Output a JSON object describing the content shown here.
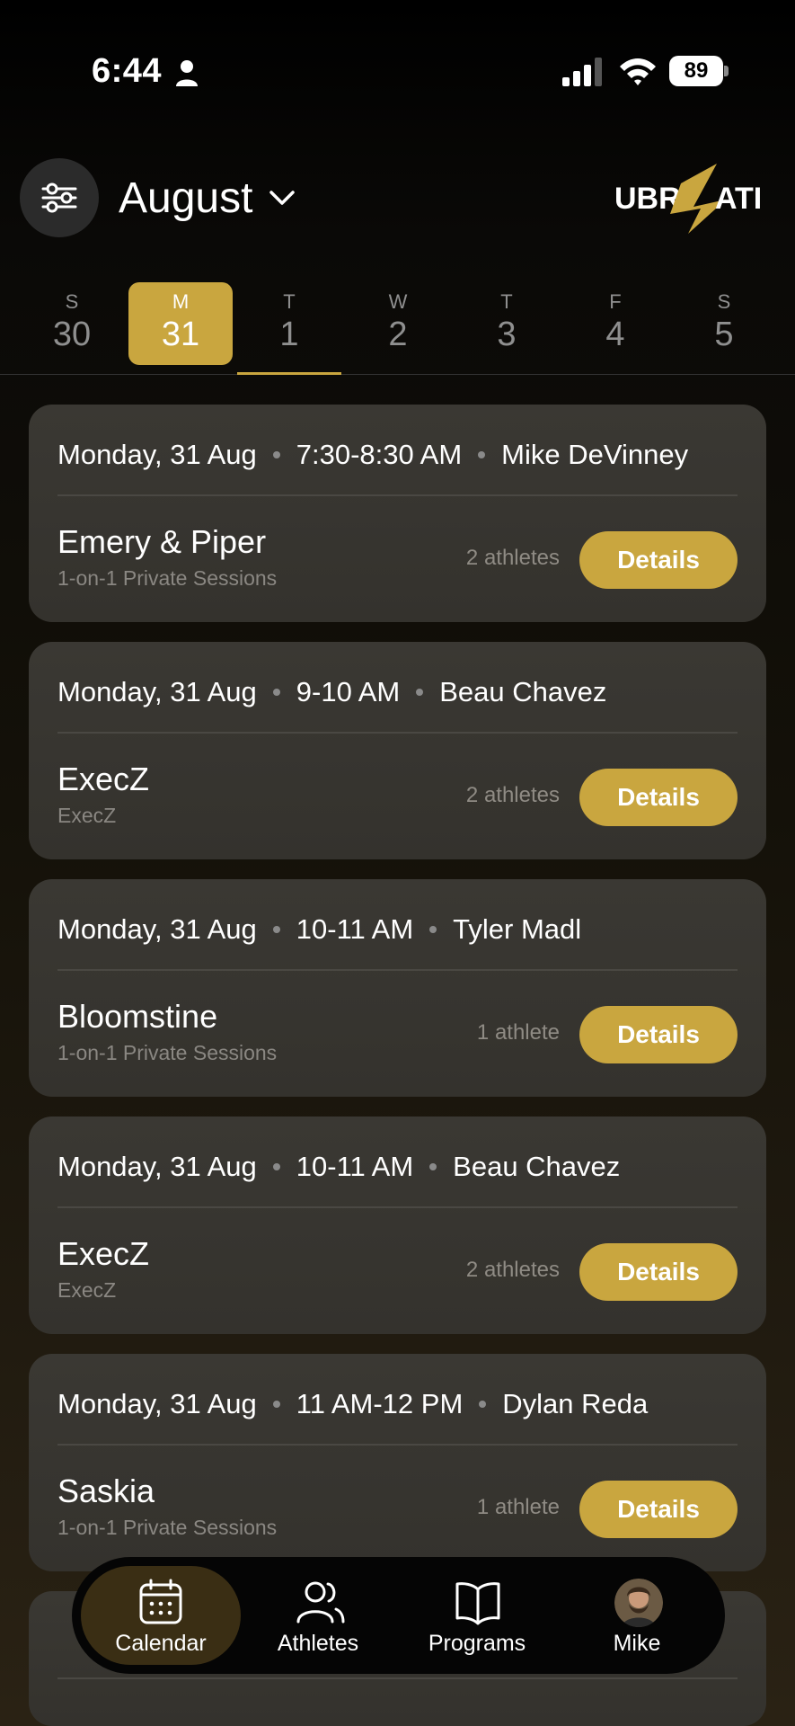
{
  "status_bar": {
    "time": "6:44",
    "battery": "89"
  },
  "header": {
    "month": "August",
    "logo_text": "UBRZATI"
  },
  "week": [
    {
      "dow": "S",
      "num": "30"
    },
    {
      "dow": "M",
      "num": "31"
    },
    {
      "dow": "T",
      "num": "1"
    },
    {
      "dow": "W",
      "num": "2"
    },
    {
      "dow": "T",
      "num": "3"
    },
    {
      "dow": "F",
      "num": "4"
    },
    {
      "dow": "S",
      "num": "5"
    }
  ],
  "sessions": [
    {
      "date": "Monday, 31 Aug",
      "time": "7:30-8:30 AM",
      "coach": "Mike DeVinney",
      "title": "Emery & Piper",
      "subtitle": "1-on-1 Private Sessions",
      "athletes": "2 athletes",
      "action": "Details"
    },
    {
      "date": "Monday, 31 Aug",
      "time": "9-10 AM",
      "coach": "Beau Chavez",
      "title": "ExecZ",
      "subtitle": "ExecZ",
      "athletes": "2 athletes",
      "action": "Details"
    },
    {
      "date": "Monday, 31 Aug",
      "time": "10-11 AM",
      "coach": "Tyler Madl",
      "title": "Bloomstine",
      "subtitle": "1-on-1 Private Sessions",
      "athletes": "1 athlete",
      "action": "Details"
    },
    {
      "date": "Monday, 31 Aug",
      "time": "10-11 AM",
      "coach": "Beau Chavez",
      "title": "ExecZ",
      "subtitle": "ExecZ",
      "athletes": "2 athletes",
      "action": "Details"
    },
    {
      "date": "Monday, 31 Aug",
      "time": "11 AM-12 PM",
      "coach": "Dylan Reda",
      "title": "Saskia",
      "subtitle": "1-on-1 Private Sessions",
      "athletes": "1 athlete",
      "action": "Details"
    }
  ],
  "nav": {
    "calendar": "Calendar",
    "athletes": "Athletes",
    "programs": "Programs",
    "profile": "Mike"
  },
  "colors": {
    "accent": "#c9a63f",
    "card": "#3a3833",
    "nav_bg": "#050505"
  }
}
